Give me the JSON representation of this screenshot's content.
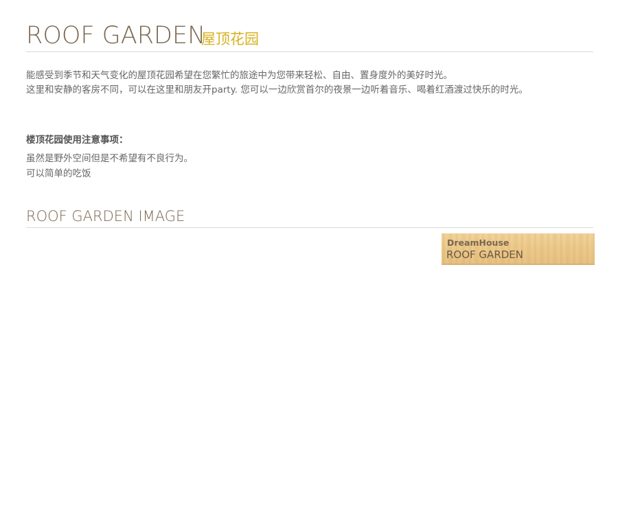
{
  "header": {
    "title_en": "ROOF GARDEN",
    "title_cn": "屋顶花园"
  },
  "intro": {
    "line1": "能感受到季节和天气变化的屋顶花园希望在您繁忙的旅途中为您带来轻松、自由、置身度外的美好时光。",
    "line2": "这里和安静的客房不同，可以在这里和朋友开party.  您可以一边欣赏首尔的夜景一边听着音乐、喝着红酒渡过快乐的时光。"
  },
  "notice": {
    "heading": "楼顶花园使用注意事项：",
    "lines": [
      "虽然是野外空间但是不希望有不良行为。",
      "可以简单的吃饭"
    ]
  },
  "image_section": {
    "title": "ROOF GARDEN IMAGE",
    "badge": {
      "brand": "DreamHouse",
      "name": "ROOF GARDEN"
    }
  },
  "colors": {
    "title_brown": "#7b6650",
    "title_gold": "#d6b21f",
    "body_text": "#666666",
    "divider": "#d9d9d9",
    "wood": "#edcb8c"
  }
}
